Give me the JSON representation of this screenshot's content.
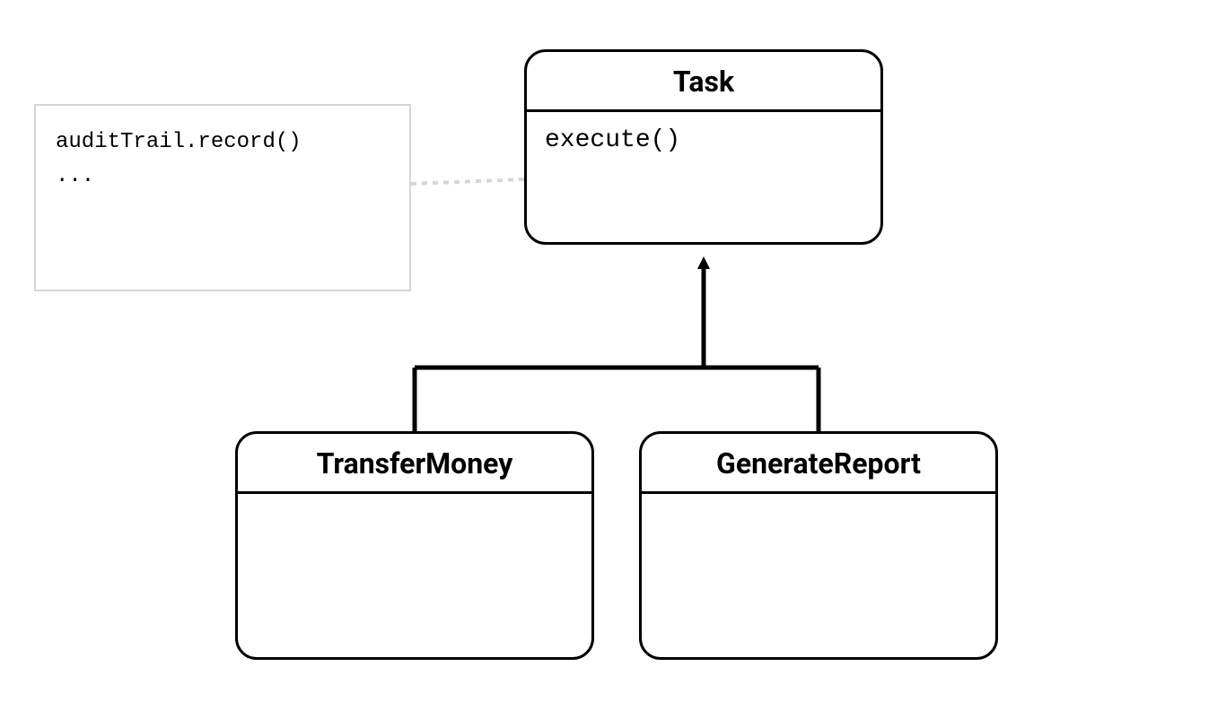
{
  "diagram": {
    "note": {
      "line1": "auditTrail.record()",
      "line2": "..."
    },
    "task": {
      "title": "Task",
      "method": "execute()"
    },
    "transfer": {
      "title": "TransferMoney"
    },
    "report": {
      "title": "GenerateReport"
    }
  }
}
